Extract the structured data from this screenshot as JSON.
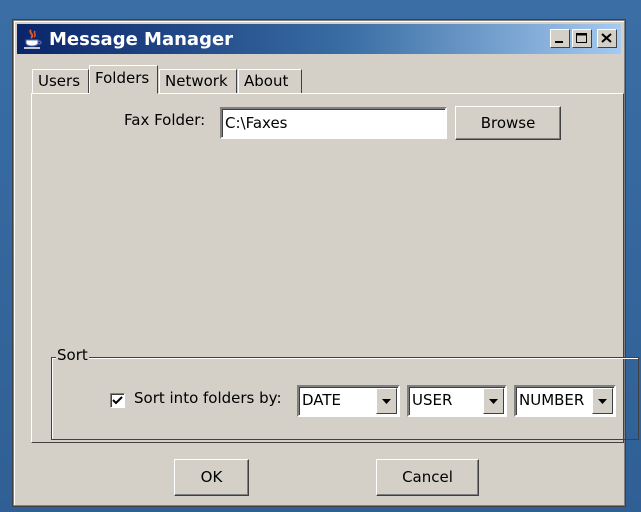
{
  "window": {
    "title": "Message Manager",
    "icon": "java-cup-icon",
    "controls": [
      "minimize-icon",
      "maximize-icon",
      "close-icon"
    ]
  },
  "tabs": [
    {
      "label": "Users",
      "active": false
    },
    {
      "label": "Folders",
      "active": true
    },
    {
      "label": "Network",
      "active": false
    },
    {
      "label": "About",
      "active": false
    }
  ],
  "folders": {
    "fax_label": "Fax Folder:",
    "fax_value": "C:\\Faxes",
    "browse_label": "Browse"
  },
  "sort": {
    "legend": "Sort",
    "checkbox_label": "Sort into folders by:",
    "checked": true,
    "combos": [
      {
        "value": "DATE"
      },
      {
        "value": "USER"
      },
      {
        "value": "NUMBER"
      }
    ]
  },
  "footer": {
    "ok_label": "OK",
    "cancel_label": "Cancel"
  },
  "colors": {
    "desktop": "#3a6ea5",
    "titlebar_start": "#0a246a",
    "titlebar_end": "#a6caf0",
    "face": "#d4d0c8"
  }
}
